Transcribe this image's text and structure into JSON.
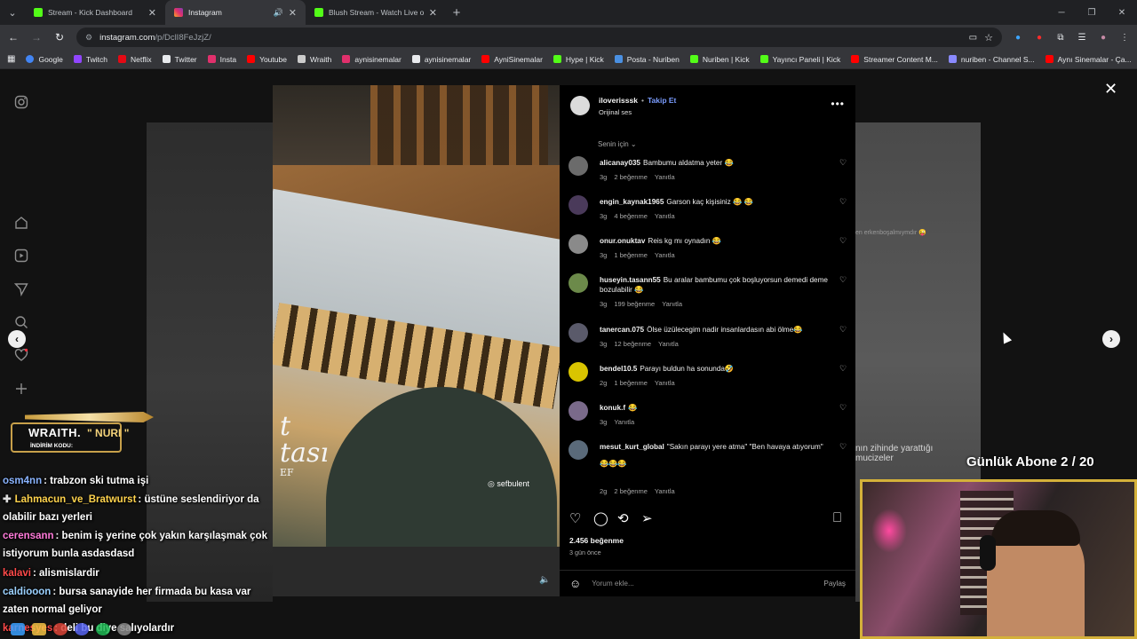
{
  "browser": {
    "tabs": [
      {
        "title": "Stream - Kick Dashboard",
        "color": "#53fc18"
      },
      {
        "title": "Instagram",
        "color": "#e1306c",
        "active": true
      },
      {
        "title": "Blush Stream - Watch Live on K",
        "color": "#53fc18"
      }
    ],
    "url_host": "instagram.com",
    "url_path": "/p/DclI8FeJzjZ/",
    "bookmarks": [
      {
        "label": "Google",
        "color": "#4285f4"
      },
      {
        "label": "Twitch",
        "color": "#9146ff"
      },
      {
        "label": "Netflix",
        "color": "#e50914"
      },
      {
        "label": "Twitter",
        "color": "#e8eaed"
      },
      {
        "label": "Insta",
        "color": "#e1306c"
      },
      {
        "label": "Youtube",
        "color": "#ff0000"
      },
      {
        "label": "Wraith",
        "color": "#cccccc"
      },
      {
        "label": "aynisinemalar",
        "color": "#e1306c"
      },
      {
        "label": "aynisinemalar",
        "color": "#e8eaed"
      },
      {
        "label": "AyniSinemalar",
        "color": "#ff0000"
      },
      {
        "label": "Hype | Kick",
        "color": "#53fc18"
      },
      {
        "label": "Posta - Nuriben",
        "color": "#4a90e2"
      },
      {
        "label": "Nuriben | Kick",
        "color": "#53fc18"
      },
      {
        "label": "Yayıncı Paneli | Kick",
        "color": "#53fc18"
      },
      {
        "label": "Streamer Content M...",
        "color": "#ff0000"
      },
      {
        "label": "nuriben - Channel S...",
        "color": "#8a8aff"
      },
      {
        "label": "Aynı Sinemalar - Ça...",
        "color": "#ff0000"
      }
    ]
  },
  "post": {
    "username": "iloverisssk",
    "follow": "Takip Et",
    "sound": "Orijinal ses",
    "for_you": "Senin için",
    "likes": "2.456 beğenme",
    "time_ago": "3 gün önce",
    "add_comment_placeholder": "Yorum ekle...",
    "share": "Paylaş",
    "reel_big_text": "t\ntası",
    "reel_small_text": "EF",
    "reel_brand": "sefbulent",
    "bg_right_text_1": "en erkenboşalmıymdır 😜",
    "bg_right_text_2": "nın zihinde yarattığı mucizeler"
  },
  "comments": [
    {
      "user": "alicanay035",
      "text": "Bambumu aldatma yeter 😂",
      "age": "3g",
      "likes": "2 beğenme",
      "reply": "Yanıtla",
      "av": "#6b6b6b"
    },
    {
      "user": "engin_kaynak1965",
      "text": "Garson kaç kişisiniz 😂 😂",
      "age": "3g",
      "likes": "4 beğenme",
      "reply": "Yanıtla",
      "av": "#4a3a5a"
    },
    {
      "user": "onur.onuktav",
      "text": "Reis kg mı oynadın 😂",
      "age": "3g",
      "likes": "1 beğenme",
      "reply": "Yanıtla",
      "av": "#8a8a8a"
    },
    {
      "user": "huseyin.tasann55",
      "text": "Bu aralar bambumu çok boşluyorsun demedi deme bozulabilir 😂",
      "age": "3g",
      "likes": "199 beğenme",
      "reply": "Yanıtla",
      "av": "#6c8a4a"
    },
    {
      "user": "tanercan.075",
      "text": "Ölse üzülecegim nadir insanlardasın abi ölme😂",
      "age": "3g",
      "likes": "12 beğenme",
      "reply": "Yanıtla",
      "av": "#5a5a6a"
    },
    {
      "user": "bendel10.5",
      "text": "Parayı buldun ha sonunda🤣",
      "age": "2g",
      "likes": "1 beğenme",
      "reply": "Yanıtla",
      "av": "#d9c400"
    },
    {
      "user": "konuk.f",
      "text": "😂",
      "age": "3g",
      "likes": "",
      "reply": "Yanıtla",
      "av": "#7a6a8a"
    },
    {
      "user": "mesut_kurt_global",
      "text": "\"Sakın parayı yere atma\" \"Ben havaya atıyorum\"",
      "text2": "😂😂😂",
      "age": "2g",
      "likes": "2 beğenme",
      "reply": "Yanıtla",
      "av": "#5a6a7a"
    }
  ],
  "overlay": {
    "wraith_name": "WRAITH.",
    "wraith_code": "\" NURI \"",
    "wraith_sub": "İNDİRİM KODU:",
    "sub_goal": "Günlük Abone 2 / 20",
    "chat": [
      {
        "user": "osm4nn",
        "color": "#8ab4ff",
        "msg": ": trabzon ski tutma işi"
      },
      {
        "user": "Lahmacun_ve_Bratwurst",
        "color": "#ffd34d",
        "msg": ": üstüne seslendiriyor da olabilir bazı yerleri"
      },
      {
        "user": "cerensann",
        "color": "#ff7ad9",
        "msg": ": benim iş yerine çok yakın karşılaşmak çok istiyorum bunla asdasdasd"
      },
      {
        "user": "kalavi",
        "color": "#ff4a4a",
        "msg": ": alismislardir"
      },
      {
        "user": "caldiooon",
        "color": "#9bd1ff",
        "msg": ": bursa sanayide her firmada bu kasa var zaten normal geliyor"
      },
      {
        "user": "karnesyes",
        "color": "#ff4a4a",
        "msg": ": deli bu diye salıyolardır"
      }
    ]
  }
}
